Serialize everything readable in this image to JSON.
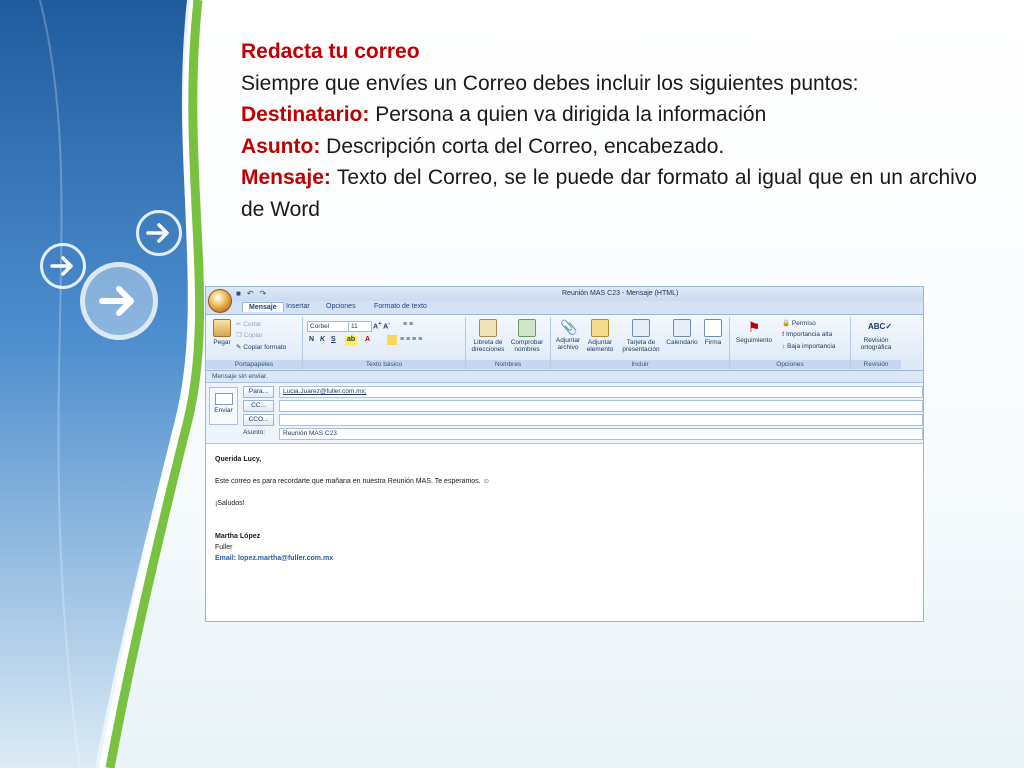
{
  "slide": {
    "heading": "Redacta tu correo",
    "intro": "Siempre que envíes un Correo debes incluir los siguientes puntos:",
    "items": [
      {
        "label": "Destinatario:",
        "text": " Persona a quien va dirigida la información"
      },
      {
        "label": "Asunto:",
        "text": " Descripción corta del Correo, encabezado."
      },
      {
        "label": "Mensaje:",
        "text": " Texto del Correo, se le puede dar formato al igual que en un archivo de Word"
      }
    ]
  },
  "window": {
    "title": "Reunión MAS C23 - Mensaje (HTML)",
    "tabs": [
      "Mensaje",
      "Insertar",
      "Opciones",
      "Formato de texto"
    ],
    "ribbon": {
      "portapapeles": {
        "label": "Portapapeles",
        "pegar": "Pegar",
        "cortar": "Cortar",
        "copiar": "Copiar",
        "copiar_formato": "Copiar formato"
      },
      "texto": {
        "label": "Texto básico",
        "font": "Corbel",
        "size": "11"
      },
      "nombres": {
        "label": "Nombres",
        "libreta": "Libreta de direcciones",
        "comprobar": "Comprobar nombres"
      },
      "incluir": {
        "label": "Incluir",
        "adjuntar_archivo": "Adjuntar archivo",
        "adjuntar_elemento": "Adjuntar elemento",
        "tarjeta": "Tarjeta de presentación",
        "calendario": "Calendario",
        "firma": "Firma"
      },
      "opciones": {
        "label": "Opciones",
        "seguimiento": "Seguimiento",
        "permiso": "Permiso",
        "alta": "Importancia alta",
        "baja": "Baja importancia"
      },
      "revision": {
        "label": "Revisión",
        "ortografica": "Revisión ortográfica"
      }
    },
    "info_bar": "Mensaje sin enviar.",
    "send_label": "Enviar",
    "fields": {
      "para_btn": "Para...",
      "para_value": "Lucia.Juarez@fuller.com.mx;",
      "cc_btn": "CC...",
      "cco_btn": "CCO...",
      "asunto_label": "Asunto:",
      "asunto_value": "Reunión MAS C23"
    },
    "body": {
      "greeting": "Querida Lucy,",
      "line1": "Este correo es para recordarte que mañana en nuestra Reunión MAS. Te esperamos. ☺",
      "closing": "¡Saludos!",
      "sig_name": "Martha López",
      "sig_company": "Fuller",
      "sig_email": "Email: lopez.martha@fuller.com.mx"
    }
  },
  "colors": {
    "accent_red": "#c00000",
    "band_blue": "#2b6fb3",
    "band_green": "#7ac142"
  }
}
